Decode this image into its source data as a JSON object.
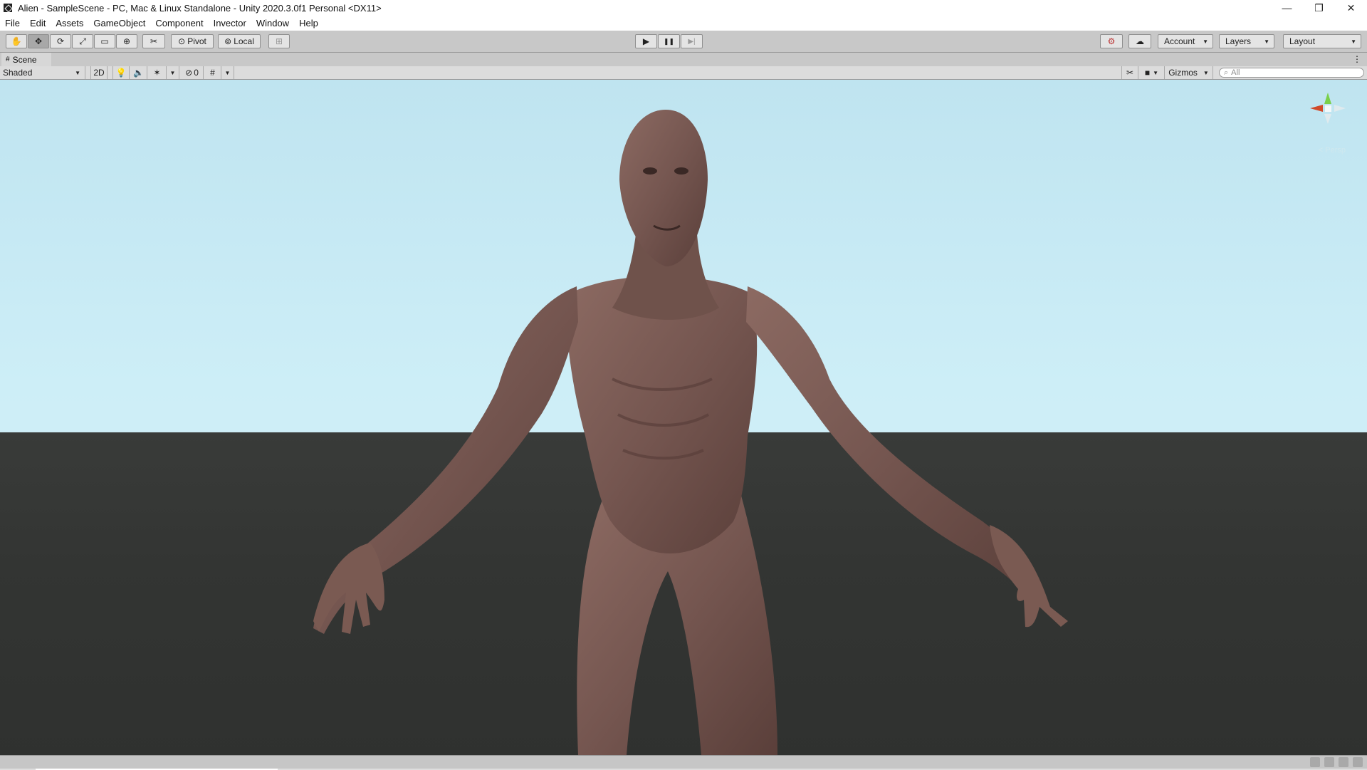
{
  "window": {
    "title": "Alien - SampleScene - PC, Mac & Linux Standalone - Unity 2020.3.0f1 Personal <DX11>",
    "controls": {
      "minimize": "—",
      "restore": "❐",
      "close": "✕"
    }
  },
  "menu": [
    "File",
    "Edit",
    "Assets",
    "GameObject",
    "Component",
    "Invector",
    "Window",
    "Help"
  ],
  "toolbar": {
    "tools": [
      {
        "icon": "hand-icon",
        "glyph": "✋"
      },
      {
        "icon": "move-icon",
        "glyph": "✥"
      },
      {
        "icon": "rotate-icon",
        "glyph": "⟳"
      },
      {
        "icon": "scale-icon",
        "glyph": "⤢"
      },
      {
        "icon": "rect-icon",
        "glyph": "▭"
      },
      {
        "icon": "transform-icon",
        "glyph": "⊕"
      },
      {
        "icon": "custom-tool-icon",
        "glyph": "✂"
      }
    ],
    "pivot_label": "Pivot",
    "local_label": "Local",
    "snap_icon": "grid-snap-icon",
    "play_glyph": "▶",
    "pause_glyph": "❚❚",
    "step_glyph": "▶|",
    "collab_icon": "collab-icon",
    "cloud_icon": "cloud-icon",
    "account_label": "Account",
    "layers_label": "Layers",
    "layout_label": "Layout"
  },
  "scene_tab": {
    "label": "Scene"
  },
  "scene_toolbar": {
    "shading_mode": "Shaded",
    "two_d_label": "2D",
    "hidden_count": "0",
    "gizmos_label": "Gizmos",
    "search_placeholder": "All"
  },
  "viewport": {
    "perspective_label": "< Persp",
    "sky_color": "#c8ebf5",
    "ground_color": "#353735",
    "model_color": "#7a5a52"
  }
}
